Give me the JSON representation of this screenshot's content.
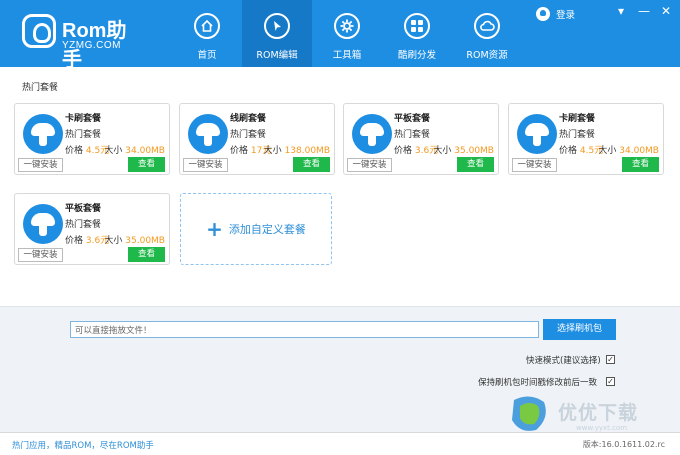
{
  "app": {
    "logo_name": "Rom助手",
    "logo_sub": "YZMG.COM",
    "login_label": "登录"
  },
  "nav": [
    {
      "label": "首页",
      "icon": "home-icon"
    },
    {
      "label": "ROM编辑",
      "icon": "play-icon",
      "active": true
    },
    {
      "label": "工具箱",
      "icon": "gear-icon"
    },
    {
      "label": "酷刷分发",
      "icon": "grid-icon"
    },
    {
      "label": "ROM资源",
      "icon": "cloud-icon"
    }
  ],
  "window_controls": {
    "minimize": "▾",
    "restore": "—",
    "close": "✕"
  },
  "section_title": "热门套餐",
  "cards": [
    {
      "name": "卡刷套餐",
      "sub": "热门套餐",
      "price_label": "价格",
      "price": "4.5元",
      "size_label": "大小",
      "size": "34.00MB",
      "install": "一键安装",
      "view": "查看"
    },
    {
      "name": "线刷套餐",
      "sub": "热门套餐",
      "price_label": "价格",
      "price": "17元",
      "size_label": "大小",
      "size": "138.00MB",
      "install": "一键安装",
      "view": "查看"
    },
    {
      "name": "平板套餐",
      "sub": "热门套餐",
      "price_label": "价格",
      "price": "3.6元",
      "size_label": "大小",
      "size": "35.00MB",
      "install": "一键安装",
      "view": "查看"
    },
    {
      "name": "卡刷套餐",
      "sub": "热门套餐",
      "price_label": "价格",
      "price": "4.5元",
      "size_label": "大小",
      "size": "34.00MB",
      "install": "一键安装",
      "view": "查看"
    },
    {
      "name": "平板套餐",
      "sub": "热门套餐",
      "price_label": "价格",
      "price": "3.6元",
      "size_label": "大小",
      "size": "35.00MB",
      "install": "一键安装",
      "view": "查看"
    }
  ],
  "add_custom_label": "添加自定义套餐",
  "drop_input": {
    "value": "可以直接拖放文件！"
  },
  "pick_button": "选择刷机包",
  "options": [
    {
      "label": "快速模式(建议选择)",
      "checked": true
    },
    {
      "label": "保持刷机包时间戳修改前后一致",
      "checked": true
    }
  ],
  "footer": {
    "text": "热门应用，精品ROM，尽在ROM助手",
    "version": "版本:16.0.1611.02.rc"
  },
  "watermark": {
    "text": "优优下载",
    "url": "www.yyxt.com"
  },
  "colors": {
    "brand": "#1e8ee3",
    "active_nav": "#1579c7",
    "view_button": "#1fb84a",
    "price": "#f39a21"
  }
}
